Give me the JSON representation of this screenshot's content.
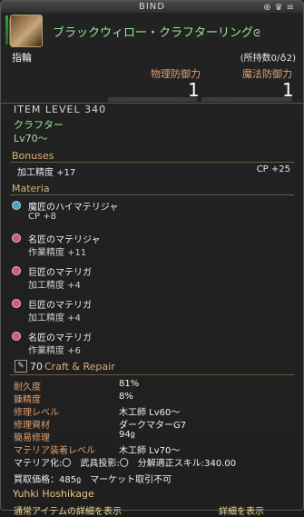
{
  "window": {
    "title": "BIND",
    "corner_icons": [
      "pin-icon",
      "crown-icon",
      "settings-icon"
    ]
  },
  "item": {
    "name": "ブラックウィロー・クラフターリング",
    "category": "指輪",
    "owned_text": "(所持数0/",
    "owned_count": "2)",
    "stats": [
      {
        "label": "物理防御力",
        "value": "1"
      },
      {
        "label": "魔法防御力",
        "value": "1"
      }
    ],
    "item_level": "ITEM LEVEL 340",
    "job": "クラフター",
    "level_req": "Lv70〜"
  },
  "bonuses": {
    "header": "Bonuses",
    "rows": [
      {
        "label": "加工精度 +17",
        "cp": "CP +25"
      }
    ]
  },
  "materia": {
    "header": "Materia",
    "slots": [
      {
        "name": "魔匠のハイマテリジャ",
        "bonus": "CP +8",
        "color": "#3aa8c8"
      },
      {
        "name": "名匠のマテリジャ",
        "bonus": "作業精度 +11",
        "color": "#e05080"
      },
      {
        "name": "巨匠のマテリガ",
        "bonus": "加工精度 +4",
        "color": "#e05080"
      },
      {
        "name": "巨匠のマテリガ",
        "bonus": "加工精度 +4",
        "color": "#e05080"
      },
      {
        "name": "名匠のマテリガ",
        "bonus": "作業精度 +6",
        "color": "#e05080"
      }
    ]
  },
  "craft_repair": {
    "level": "70",
    "title": "Craft & Repair",
    "rows": [
      {
        "label": "耐久度",
        "value": "81%"
      },
      {
        "label": "錬精度",
        "value": "8%"
      },
      {
        "label": "修理レベル",
        "value": "木工師 Lv60〜"
      },
      {
        "label": "修理資材",
        "value": "ダークマターG7"
      },
      {
        "label": "簡易修理",
        "value": "94ჲ"
      },
      {
        "label": "マテリア装着レベル",
        "value": "木工師 Lv70〜"
      }
    ],
    "flags": "マテリア化:〇　武具投影:〇　分解適正スキル:340.00",
    "sell": "買取価格：485ჲ　マーケット取引不可"
  },
  "crafter": "Yuhki Hoshikage",
  "footer": {
    "left": "通常アイテムの詳細を表示",
    "right": "詳細を表示"
  },
  "colors": {
    "name_green": "#9be79b",
    "label_orange": "#e0a070",
    "section_gold": "#d8b07a"
  }
}
